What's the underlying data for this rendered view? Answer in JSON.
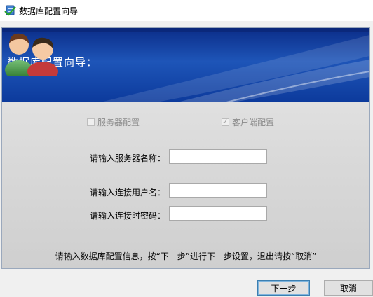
{
  "window": {
    "title": "数据库配置向导"
  },
  "banner": {
    "title": "数据库配置向导："
  },
  "options": {
    "server_config": {
      "label": "服务器配置",
      "checked": false
    },
    "client_config": {
      "label": "客户端配置",
      "checked": true
    }
  },
  "fields": {
    "server_name": {
      "label": "请输入服务器名称：",
      "value": ""
    },
    "username": {
      "label": "请输入连接用户名：",
      "value": ""
    },
    "password": {
      "label": "请输入连接时密码：",
      "value": ""
    }
  },
  "hint": "请输入数据库配置信息，按“下一步”进行下一步设置，退出请按“取消”",
  "buttons": {
    "next": "下一步",
    "cancel": "取消"
  },
  "icons": {
    "app": "database-wizard-icon",
    "banner": "users-icon",
    "check": "checkmark-icon"
  },
  "colors": {
    "banner": "#1e55b8",
    "title_text": "#ffffff",
    "disabled_text": "#8a8a8a"
  }
}
